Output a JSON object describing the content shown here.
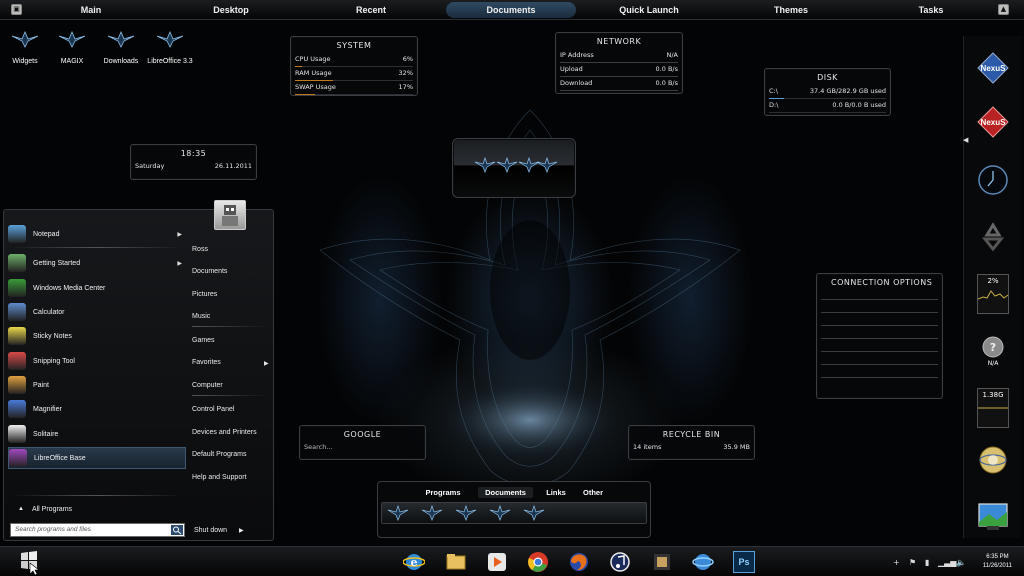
{
  "topbar": {
    "tabs": [
      "Main",
      "Desktop",
      "Recent",
      "Documents",
      "Quick Launch",
      "Themes",
      "Tasks"
    ],
    "active": "Documents"
  },
  "desktop_icons": [
    "Widgets",
    "MAGIX",
    "Downloads",
    "LibreOffice 3.3"
  ],
  "system": {
    "title": "SYSTEM",
    "rows": [
      {
        "label": "CPU Usage",
        "value": "6%",
        "fill": 0.06
      },
      {
        "label": "RAM Usage",
        "value": "32%",
        "fill": 0.32
      },
      {
        "label": "SWAP Usage",
        "value": "17%",
        "fill": 0.17
      }
    ]
  },
  "network": {
    "title": "NETWORK",
    "rows": [
      {
        "label": "IP Address",
        "value": "N/A"
      },
      {
        "label": "Upload",
        "value": "0.0 B/s"
      },
      {
        "label": "Download",
        "value": "0.0 B/s"
      }
    ]
  },
  "disk": {
    "title": "DISK",
    "rows": [
      {
        "label": "C:\\",
        "value": "37.4 GB/282.9 GB used",
        "fill": 0.13
      },
      {
        "label": "D:\\",
        "value": "0.0 B/0.0 B used",
        "fill": 0.0
      }
    ]
  },
  "clock_gadget": {
    "time": "18:35",
    "day": "Saturday",
    "date": "26.11.2011"
  },
  "google": {
    "title": "GOOGLE",
    "placeholder": "Search..."
  },
  "recycle": {
    "title": "RECYCLE BIN",
    "items": "14 items",
    "size": "35.9 MB"
  },
  "connection": {
    "title": "CONNECTION OPTIONS"
  },
  "start_menu": {
    "programs": [
      {
        "label": "Notepad",
        "arrow": true,
        "color": "#5aa0d8"
      },
      {
        "label": "Getting Started",
        "arrow": true,
        "color": "#6fb06a"
      },
      {
        "label": "Windows Media Center",
        "arrow": false,
        "color": "#3a9a3a"
      },
      {
        "label": "Calculator",
        "arrow": false,
        "color": "#5d8ccc"
      },
      {
        "label": "Sticky Notes",
        "arrow": false,
        "color": "#e8d84a"
      },
      {
        "label": "Snipping Tool",
        "arrow": false,
        "color": "#d84a4a"
      },
      {
        "label": "Paint",
        "arrow": false,
        "color": "#e0a040"
      },
      {
        "label": "Magnifier",
        "arrow": false,
        "color": "#4a7ad8"
      },
      {
        "label": "Solitaire",
        "arrow": false,
        "color": "#f0f0f0"
      },
      {
        "label": "LibreOffice Base",
        "arrow": false,
        "color": "#a04ac0",
        "selected": true
      }
    ],
    "all_programs": "All Programs",
    "search_placeholder": "Search programs and files",
    "right_links": [
      "Ross",
      "Documents",
      "Pictures",
      "Music",
      "Games",
      "Favorites",
      "Computer",
      "Control Panel",
      "Devices and Printers",
      "Default Programs",
      "Help and Support"
    ],
    "favorites_arrow": true,
    "shutdown": "Shut down"
  },
  "sidebar": {
    "cpu_meter": "2%",
    "net_meter": "N/A",
    "mem_meter": "1.38G",
    "logo_text": "NexuS"
  },
  "dock": {
    "tabs": [
      "Programs",
      "Documents",
      "Links",
      "Other"
    ],
    "active": "Documents"
  },
  "taskbar": {
    "apps": [
      "internet-explorer",
      "windows-explorer",
      "media-player",
      "chrome",
      "firefox",
      "itunes",
      "game",
      "ie-alt",
      "photoshop"
    ],
    "ps_label": "Ps",
    "time": "6:35 PM",
    "date": "11/26/2011"
  }
}
